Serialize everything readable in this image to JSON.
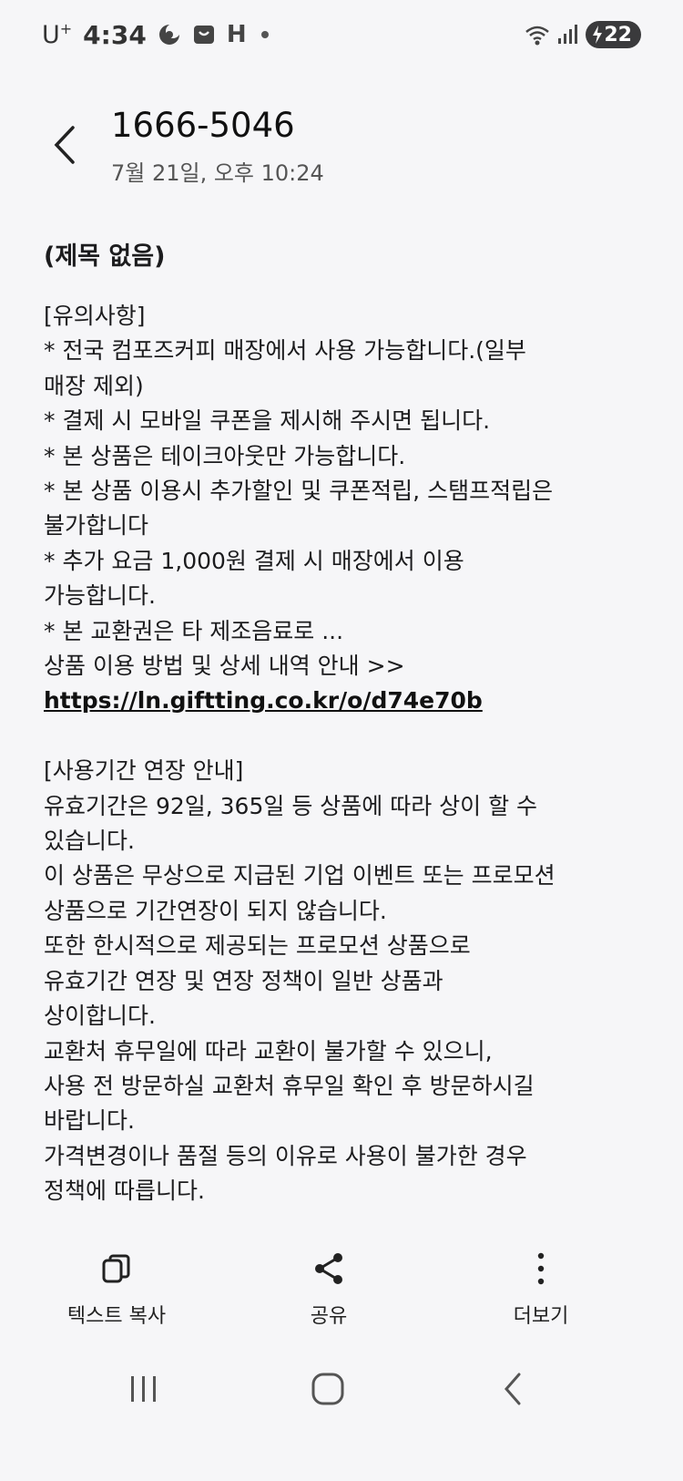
{
  "status_bar": {
    "carrier": "U",
    "carrier_sup": "+",
    "time": "4:34",
    "h_indicator": "H",
    "battery": "22",
    "icons": [
      "moon-icon",
      "app-notification-icon",
      "wifi-icon",
      "signal-icon",
      "battery-charging-icon"
    ]
  },
  "header": {
    "sender": "1666-5046",
    "date": "7월 21일, 오후 10:24"
  },
  "message": {
    "subject": "(제목 없음)",
    "block1": [
      "[유의사항]",
      "* 전국 컴포즈커피 매장에서 사용 가능합니다.(일부",
      "매장 제외)",
      "* 결제 시 모바일 쿠폰을 제시해 주시면 됩니다.",
      "* 본 상품은 테이크아웃만 가능합니다.",
      "* 본 상품 이용시 추가할인 및 쿠폰적립, 스탬프적립은",
      "불가합니다",
      "* 추가 요금 1,000원 결제 시 매장에서 이용",
      "가능합니다.",
      "* 본 교환권은 타 제조음료로 ...",
      "상품 이용 방법 및 상세 내역 안내  >>"
    ],
    "link": "https://ln.giftting.co.kr/o/d74e70b",
    "block2": [
      "[사용기간 연장 안내]",
      "유효기간은 92일, 365일 등 상품에 따라 상이 할 수",
      "있습니다.",
      "이 상품은 무상으로 지급된 기업 이벤트 또는 프로모션",
      "상품으로 기간연장이 되지 않습니다.",
      "또한 한시적으로 제공되는 프로모션 상품으로",
      "유효기간 연장 및 연장 정책이 일반 상품과",
      "상이합니다.",
      "교환처 휴무일에 따라 교환이 불가할 수 있으니,",
      "사용 전 방문하실 교환처 휴무일 확인 후 방문하시길",
      "바랍니다.",
      "가격변경이나 품절 등의 이유로 사용이 불가한 경우",
      "정책에 따릅니다."
    ]
  },
  "toolbar": {
    "copy_label": "텍스트 복사",
    "share_label": "공유",
    "more_label": "더보기"
  }
}
